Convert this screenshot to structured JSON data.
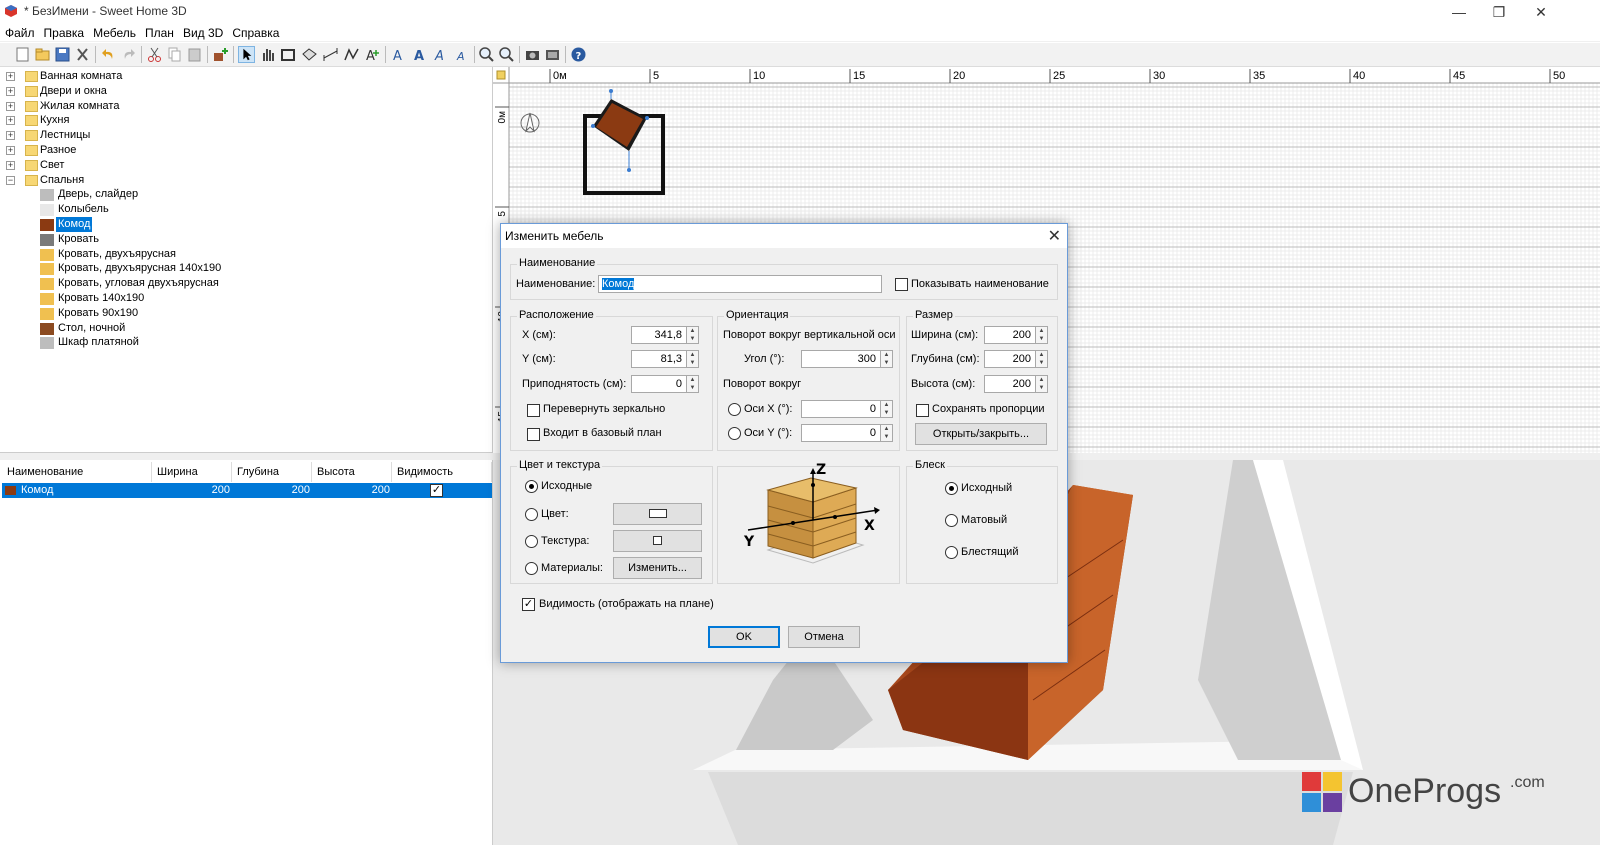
{
  "window": {
    "title": "* БезИмени - Sweet Home 3D",
    "minimize": "—",
    "maximize": "❐",
    "close": "✕"
  },
  "menu": [
    "Файл",
    "Правка",
    "Мебель",
    "План",
    "Вид 3D",
    "Справка"
  ],
  "toolbar": {
    "icons": [
      "new-icon",
      "open-icon",
      "save-icon",
      "cut-tool-icon",
      "undo-icon",
      "redo-icon",
      "cut-icon",
      "copy-icon",
      "paste-icon",
      "add-furniture-icon",
      "select-icon",
      "pan-icon",
      "create-walls-icon",
      "create-rooms-icon",
      "create-dimensions-icon",
      "create-polylines-icon",
      "add-text-icon",
      "text-style-icon",
      "bold-icon",
      "italic-icon",
      "text-size-icon",
      "zoom-in-icon",
      "zoom-out-icon",
      "photo-icon",
      "video-icon",
      "help-icon"
    ]
  },
  "catalog": {
    "categories": [
      "Ванная комната",
      "Двери и окна",
      "Жилая комната",
      "Кухня",
      "Лестницы",
      "Разное",
      "Свет",
      "Спальня"
    ],
    "items": [
      "Дверь, слайдер",
      "Колыбель",
      "Комод",
      "Кровать",
      "Кровать, двухъярусная",
      "Кровать, двухъярусная 140x190",
      "Кровать, угловая двухъярусная",
      "Кровать 140x190",
      "Кровать 90x190",
      "Стол, ночной",
      "Шкаф платяной"
    ],
    "selected_item": "Комод"
  },
  "furniture_list": {
    "columns": [
      "Наименование",
      "Ширина",
      "Глубина",
      "Высота",
      "Видимость"
    ],
    "rows": [
      {
        "name": "Комод",
        "width": "200",
        "depth": "200",
        "height": "200",
        "visible": "✓"
      }
    ]
  },
  "plan": {
    "ruler_top": [
      "0м",
      "5",
      "10",
      "15",
      "20",
      "25",
      "30",
      "35",
      "40",
      "45",
      "50"
    ],
    "ruler_left": [
      "0м",
      "5",
      "10",
      "15"
    ]
  },
  "dialog": {
    "title": "Изменить мебель",
    "name_group": "Наименование",
    "name_label": "Наименование:",
    "name_value": "Комод",
    "show_name_label": "Показывать наименование",
    "location_group": "Расположение",
    "x_label": "X (см):",
    "x_value": "341,8",
    "y_label": "Y (см):",
    "y_value": "81,3",
    "elevation_label": "Приподнятость (см):",
    "elevation_value": "0",
    "mirror_label": "Перевернуть зеркально",
    "base_plan_label": "Входит в базовый план",
    "orientation_group": "Ориентация",
    "vertical_rotation_label": "Поворот вокруг вертикальной оси",
    "angle_label": "Угол (°):",
    "angle_value": "300",
    "rotation_around_label": "Поворот вокруг",
    "axis_x_label": "Оси X (°):",
    "axis_x_value": "0",
    "axis_y_label": "Оси Y (°):",
    "axis_y_value": "0",
    "size_group": "Размер",
    "width_label": "Ширина (см):",
    "width_value": "200",
    "depth_label": "Глубина (см):",
    "depth_value": "200",
    "height_label": "Высота (см):",
    "height_value": "200",
    "keep_proportions_label": "Сохранять пропорции",
    "open_close_button": "Открыть/закрыть...",
    "color_group": "Цвет и текстура",
    "original_label": "Исходные",
    "color_label": "Цвет:",
    "texture_label": "Текстура:",
    "materials_label": "Материалы:",
    "modify_button": "Изменить...",
    "shininess_group": "Блеск",
    "shin_default": "Исходный",
    "shin_matt": "Матовый",
    "shin_shiny": "Блестящий",
    "axis_z": "Z",
    "axis_x": "X",
    "axis_y": "Y",
    "visible_label": "Видимость (отображать на плане)",
    "ok_button": "OK",
    "cancel_button": "Отмена"
  },
  "watermark": {
    "brand": "OneProgs",
    "suffix": ".com"
  },
  "colors": {
    "selection": "#0078d7",
    "furniture_brown": "#8b3a12",
    "furniture_orange": "#c8642a"
  }
}
